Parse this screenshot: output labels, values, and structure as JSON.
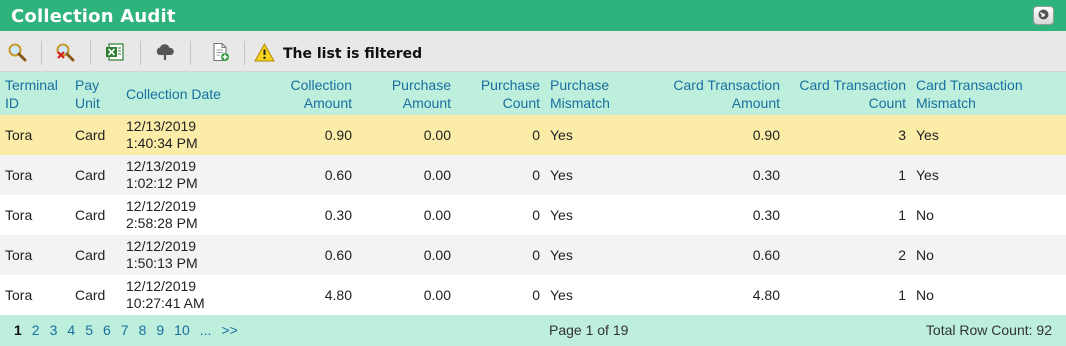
{
  "window": {
    "title": "Collection Audit"
  },
  "toolbar": {
    "filter_message": "The list is filtered"
  },
  "columns": [
    {
      "line1": "Terminal",
      "line2": "ID"
    },
    {
      "line1": "Pay",
      "line2": "Unit"
    },
    {
      "line1": "Collection Date",
      "line2": ""
    },
    {
      "line1": "Collection",
      "line2": "Amount"
    },
    {
      "line1": "Purchase",
      "line2": "Amount"
    },
    {
      "line1": "Purchase",
      "line2": "Count"
    },
    {
      "line1": "Purchase",
      "line2": "Mismatch"
    },
    {
      "line1": "Card Transaction",
      "line2": "Amount"
    },
    {
      "line1": "Card Transaction",
      "line2": "Count"
    },
    {
      "line1": "Card Transaction",
      "line2": "Mismatch"
    }
  ],
  "rows": [
    {
      "terminal_id": "Tora",
      "pay_unit": "Card",
      "date": "12/13/2019",
      "time": "1:40:34 PM",
      "collection_amount": "0.90",
      "purchase_amount": "0.00",
      "purchase_count": "0",
      "purchase_mismatch": "Yes",
      "card_amount": "0.90",
      "card_count": "3",
      "card_mismatch": "Yes"
    },
    {
      "terminal_id": "Tora",
      "pay_unit": "Card",
      "date": "12/13/2019",
      "time": "1:02:12 PM",
      "collection_amount": "0.60",
      "purchase_amount": "0.00",
      "purchase_count": "0",
      "purchase_mismatch": "Yes",
      "card_amount": "0.30",
      "card_count": "1",
      "card_mismatch": "Yes"
    },
    {
      "terminal_id": "Tora",
      "pay_unit": "Card",
      "date": "12/12/2019",
      "time": "2:58:28 PM",
      "collection_amount": "0.30",
      "purchase_amount": "0.00",
      "purchase_count": "0",
      "purchase_mismatch": "Yes",
      "card_amount": "0.30",
      "card_count": "1",
      "card_mismatch": "No"
    },
    {
      "terminal_id": "Tora",
      "pay_unit": "Card",
      "date": "12/12/2019",
      "time": "1:50:13 PM",
      "collection_amount": "0.60",
      "purchase_amount": "0.00",
      "purchase_count": "0",
      "purchase_mismatch": "Yes",
      "card_amount": "0.60",
      "card_count": "2",
      "card_mismatch": "No"
    },
    {
      "terminal_id": "Tora",
      "pay_unit": "Card",
      "date": "12/12/2019",
      "time": "10:27:41 AM",
      "collection_amount": "4.80",
      "purchase_amount": "0.00",
      "purchase_count": "0",
      "purchase_mismatch": "Yes",
      "card_amount": "4.80",
      "card_count": "1",
      "card_mismatch": "No"
    }
  ],
  "pager": {
    "pages": [
      "1",
      "2",
      "3",
      "4",
      "5",
      "6",
      "7",
      "8",
      "9",
      "10",
      "...",
      ">>"
    ],
    "current_page": "1",
    "page_info": "Page 1 of 19",
    "row_count": "Total Row Count: 92"
  },
  "colors": {
    "title_bar": "#2fb37d",
    "header_bg": "#bdefdc",
    "header_text": "#1a6fa0",
    "selected_row": "#fbeca8",
    "alt_row": "#f3f3f3"
  },
  "icons": [
    "search-icon",
    "clear-filter-icon",
    "export-excel-icon",
    "upload-icon",
    "export-document-icon",
    "warning-icon",
    "minimize-icon"
  ]
}
